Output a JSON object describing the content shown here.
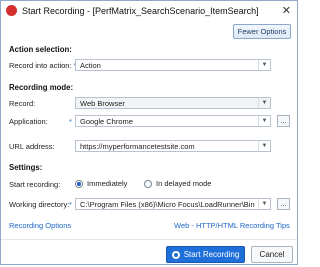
{
  "window": {
    "title": "Start Recording - [PerfMatrix_SearchScenario_ItemSearch]",
    "close_glyph": "✕"
  },
  "toolbar": {
    "fewer_options": "Fewer Options"
  },
  "action_selection": {
    "section_title": "Action selection:",
    "record_into_action_label": "Record into action:",
    "record_into_action_value": "Action"
  },
  "recording_mode": {
    "section_title": "Recording mode:",
    "record_label": "Record:",
    "record_value": "Web Browser",
    "application_label": "Application:",
    "application_value": "Google Chrome",
    "url_label": "URL address:",
    "url_value": "https://myperformancetestsite.com"
  },
  "settings": {
    "section_title": "Settings:",
    "start_recording_label": "Start recording:",
    "immediately": "Immediately",
    "delayed": "In delayed mode",
    "selected": "Immediately",
    "working_dir_label": "Working directory:",
    "working_dir_value": "C:\\Program Files (x86)\\Micro Focus\\LoadRunner\\Bin"
  },
  "links": {
    "recording_options": "Recording Options",
    "tips": "Web - HTTP/HTML Recording Tips"
  },
  "buttons": {
    "start": "Start Recording",
    "cancel": "Cancel",
    "browse": "..."
  },
  "required_marker": "*",
  "icons": {
    "app": "loadrunner-icon",
    "start": "record-icon",
    "dropdown": "chevron-down-icon"
  },
  "colors": {
    "accent": "#1e6fd9",
    "link": "#1f66c7",
    "border": "#8fa9c8"
  }
}
